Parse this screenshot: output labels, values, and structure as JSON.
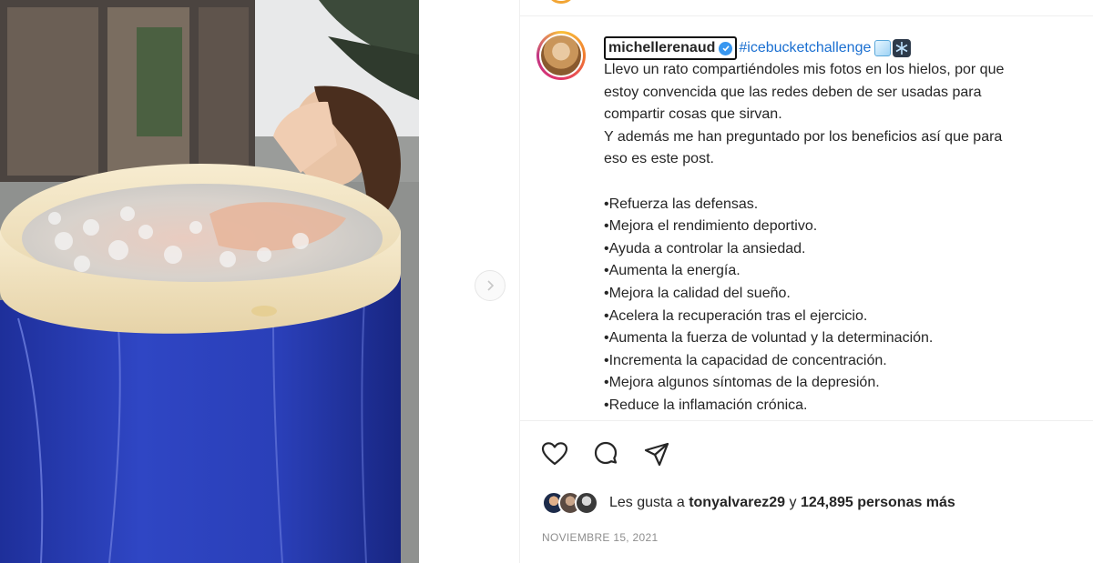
{
  "post": {
    "username": "michellerenaud",
    "hashtag": "#icebucketchallenge",
    "caption_lines": [
      "Llevo un rato compartiéndoles mis fotos en los hielos, por que",
      "estoy convencida que las redes deben de ser usadas para",
      "compartir cosas que sirvan.",
      "Y además me han preguntado por los beneficios así que para",
      "eso es este post.",
      "",
      "•Refuerza las defensas.",
      "•Mejora el rendimiento deportivo.",
      "•Ayuda a controlar la ansiedad.",
      "•Aumenta la energía.",
      "•Mejora la calidad del sueño.",
      "•Acelera la recuperación tras el ejercicio.",
      "•Aumenta la fuerza de voluntad y la determinación.",
      "•Incrementa la capacidad de concentración.",
      "•Mejora algunos síntomas de la depresión.",
      "•Reduce la inflamación crónica."
    ],
    "likes_prefix": "Les gusta a",
    "likes_user": "tonyalvarez29",
    "likes_connector": "y",
    "likes_count": "124,895 personas más",
    "date": "NOVIEMBRE 15, 2021"
  },
  "icons": {
    "like": "heart-icon",
    "comment": "comment-icon",
    "share": "share-icon",
    "next": "chevron-right-icon",
    "verified": "verified-badge-icon"
  },
  "colors": {
    "hashtag": "#1a6fd1",
    "verified": "#3897f0",
    "tub_blue": "#2a3fb8",
    "text": "#262626",
    "muted": "#8e8e8e"
  }
}
